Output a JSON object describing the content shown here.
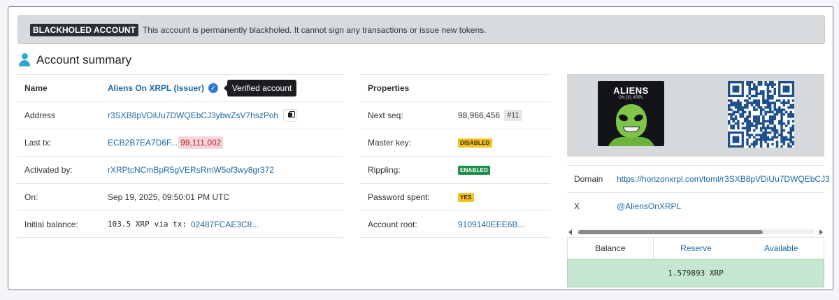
{
  "banner": {
    "badge": "BLACKHOLED ACCOUNT",
    "message": "This account is permanently blackholed. It cannot sign any transactions or issue new tokens."
  },
  "summary": {
    "title": "Account summary",
    "icon": "user-icon"
  },
  "left_table": {
    "name_label": "Name",
    "name_value": "Aliens On XRPL (Issuer)",
    "verified_tooltip": "Verified account",
    "address_label": "Address",
    "address_value": "r3SXB8pVDiUu7DWQEbCJ3ybwZsV7hszPoh",
    "last_tx_label": "Last tx:",
    "last_tx_hash": "ECB2B7EA7D6F...",
    "last_tx_ledger": "99,111,002",
    "activated_label": "Activated by:",
    "activated_value": "rXRPtcNCmBpR5gVERsRmW5of3wy8gr372",
    "on_label": "On:",
    "on_value": "Sep 19, 2025, 09:50:01 PM UTC",
    "initial_balance_label": "Initial balance:",
    "initial_balance_amount": "103.5 XRP",
    "initial_balance_via": "via tx:",
    "initial_balance_tx": "02487FCAE3C8..."
  },
  "properties": {
    "header": "Properties",
    "next_seq_label": "Next seq:",
    "next_seq_value": "98,966,456",
    "next_seq_badge": "#11",
    "master_key_label": "Master key:",
    "master_key_tag": "DISABLED",
    "rippling_label": "Rippling:",
    "rippling_tag": "ENABLED",
    "password_label": "Password spent:",
    "password_tag": "YES",
    "account_root_label": "Account root:",
    "account_root_value": "9109140EEE6B..."
  },
  "right_panel": {
    "logo_title": "ALIENS",
    "logo_subtitle": "ON {X} XRPL",
    "domain_label": "Domain",
    "domain_value": "https://horizonxrpl.com/toml/r3SXB8pVDiUu7DWQEbCJ3",
    "x_label": "X",
    "x_value": "@AliensOnXRPL",
    "tabs": [
      "Balance",
      "Reserve",
      "Available"
    ],
    "balance_value": "1.579893 XRP"
  },
  "colors": {
    "link": "#1c6aa7",
    "verified": "#2a7ad6",
    "tag_green": "#1f8f4e",
    "tag_yellow": "#f4c21a",
    "balance_bg": "#c5e6cf"
  }
}
